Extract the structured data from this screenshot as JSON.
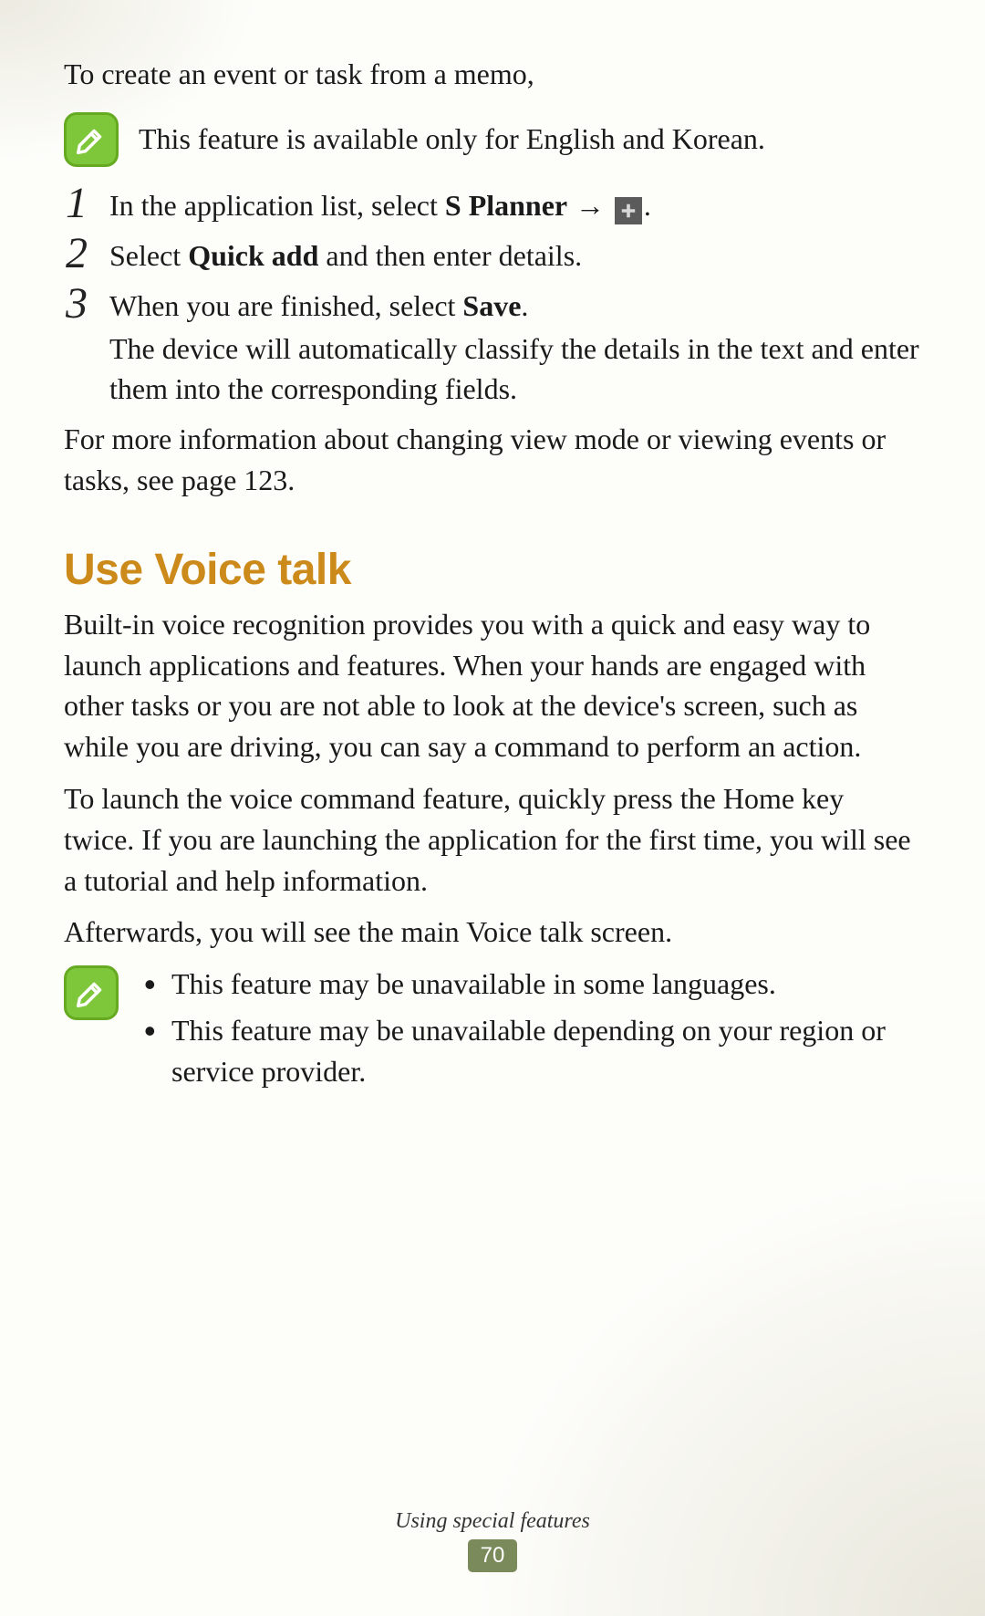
{
  "page": {
    "intro": "To create an event or task from a memo,",
    "note1": "This feature is available only for English and Korean.",
    "steps": {
      "s1_a": "In the application list, select ",
      "s1_b": "S Planner",
      "s1_c": " → ",
      "s1_d": ".",
      "s2_a": "Select ",
      "s2_b": "Quick add",
      "s2_c": " and then enter details.",
      "s3_a": "When you are finished, select ",
      "s3_b": "Save",
      "s3_c": ".",
      "s3_sub": "The device will automatically classify the details in the text and enter them into the corresponding fields."
    },
    "moreinfo": "For more information about changing view mode or viewing events or tasks, see page 123.",
    "heading": "Use Voice talk",
    "voice_p1": "Built-in voice recognition provides you with a quick and easy way to launch applications and features. When your hands are engaged with other tasks or you are not able to look at the device's screen, such as while you are driving, you can say a command to perform an action.",
    "voice_p2": "To launch the voice command feature, quickly press the Home key twice. If you are launching the application for the first time, you will see a tutorial and help information.",
    "voice_p3": "Afterwards, you will see the main Voice talk screen.",
    "note2": {
      "b1": "This feature may be unavailable in some languages.",
      "b2": "This feature may be unavailable depending on your region or service provider."
    },
    "footer": {
      "section": "Using special features",
      "pagenum": "70"
    }
  }
}
